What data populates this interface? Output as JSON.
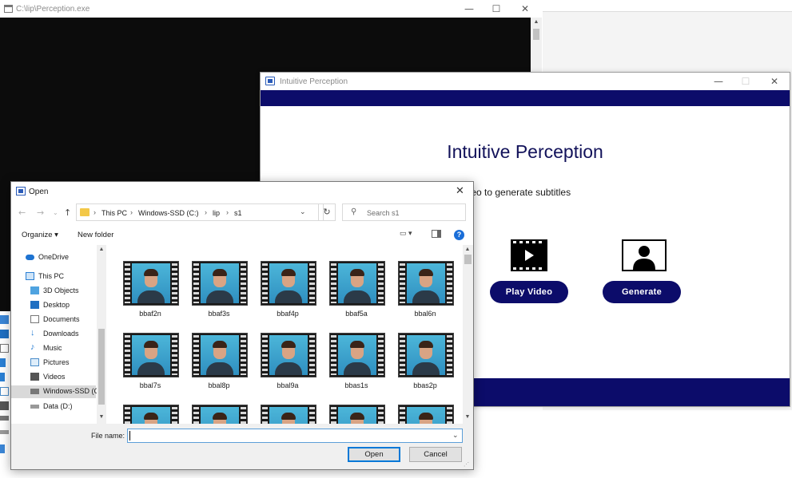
{
  "console": {
    "title": "C:\\lip\\Perception.exe",
    "controls": {
      "minimize": "—",
      "maximize": "☐",
      "close": "✕"
    }
  },
  "ip_window": {
    "title": "Intuitive Perception",
    "heading": "Intuitive Perception",
    "subtitle": "d a video to generate subtitles",
    "controls": {
      "minimize": "—",
      "maximize": "☐",
      "close": "✕"
    },
    "buttons": {
      "play": "Play Video",
      "generate": "Generate"
    },
    "colors": {
      "accent": "#0c0c6a"
    }
  },
  "open_dialog": {
    "title": "Open",
    "close": "✕",
    "breadcrumb": [
      "This PC",
      "Windows-SSD (C:)",
      "lip",
      "s1"
    ],
    "search_placeholder": "Search s1",
    "toolbar": {
      "organize": "Organize ▾",
      "new_folder": "New folder",
      "help": "?"
    },
    "nav_items": [
      {
        "label": "OneDrive",
        "icon": "cloud-icon"
      },
      {
        "label": "This PC",
        "icon": "computer-icon"
      },
      {
        "label": "3D Objects",
        "icon": "cube-icon"
      },
      {
        "label": "Desktop",
        "icon": "desktop-icon"
      },
      {
        "label": "Documents",
        "icon": "document-icon"
      },
      {
        "label": "Downloads",
        "icon": "download-icon"
      },
      {
        "label": "Music",
        "icon": "music-icon"
      },
      {
        "label": "Pictures",
        "icon": "picture-icon"
      },
      {
        "label": "Videos",
        "icon": "video-icon"
      },
      {
        "label": "Windows-SSD (C",
        "icon": "drive-icon"
      },
      {
        "label": "Data (D:)",
        "icon": "drive-icon"
      }
    ],
    "files": [
      "bbaf2n",
      "bbaf3s",
      "bbaf4p",
      "bbaf5a",
      "bbal6n",
      "bbal7s",
      "bbal8p",
      "bbal9a",
      "bbas1s",
      "bbas2p",
      "",
      "",
      "",
      "",
      ""
    ],
    "footer": {
      "file_name_label": "File name:",
      "file_name_value": "",
      "open": "Open",
      "cancel": "Cancel"
    }
  }
}
